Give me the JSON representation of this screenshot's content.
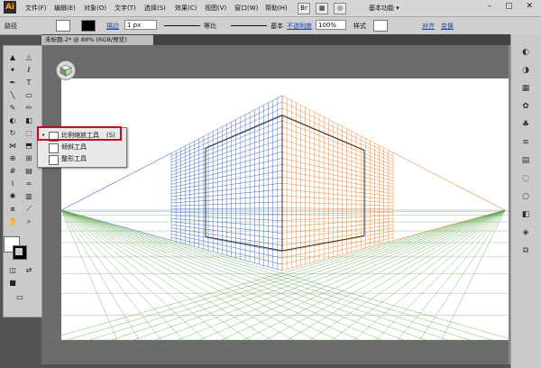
{
  "app": {
    "logo": "Ai",
    "menus": [
      "文件(F)",
      "编辑(E)",
      "对象(O)",
      "文字(T)",
      "选择(S)",
      "效果(C)",
      "视图(V)",
      "窗口(W)",
      "帮助(H)"
    ],
    "workspace": "基本功能 ▾",
    "window_controls": "– ▢ ✕"
  },
  "controlbar": {
    "selection_label": "路径",
    "stroke_label": "描边",
    "stroke_weight": "1 px",
    "stroke_profile_label": "等比",
    "brush_label": "基本",
    "opacity_label": "不透明度",
    "opacity_value": "100%",
    "style_label": "样式",
    "align_label": "对齐",
    "transform_label": "变换"
  },
  "document": {
    "tab_title": "未标题-2* @ 88% (RGB/预览)"
  },
  "tools": [
    {
      "name": "selection-tool-icon",
      "glyph": "▲"
    },
    {
      "name": "direct-selection-tool-icon",
      "glyph": "△"
    },
    {
      "name": "magic-wand-icon",
      "glyph": "✦"
    },
    {
      "name": "lasso-icon",
      "glyph": "ℓ"
    },
    {
      "name": "pen-tool-icon",
      "glyph": "✒"
    },
    {
      "name": "type-tool-icon",
      "glyph": "T"
    },
    {
      "name": "line-tool-icon",
      "glyph": "╲"
    },
    {
      "name": "rectangle-tool-icon",
      "glyph": "▭"
    },
    {
      "name": "paintbrush-icon",
      "glyph": "✎"
    },
    {
      "name": "pencil-icon",
      "glyph": "✏"
    },
    {
      "name": "blob-brush-icon",
      "glyph": "◐"
    },
    {
      "name": "eraser-icon",
      "glyph": "◧"
    },
    {
      "name": "rotate-tool-icon",
      "glyph": "↻"
    },
    {
      "name": "scale-tool-icon",
      "glyph": "⬚"
    },
    {
      "name": "width-tool-icon",
      "glyph": "⋈"
    },
    {
      "name": "free-transform-icon",
      "glyph": "⬒"
    },
    {
      "name": "shape-builder-icon",
      "glyph": "⊕"
    },
    {
      "name": "perspective-grid-icon",
      "glyph": "⊞"
    },
    {
      "name": "mesh-tool-icon",
      "glyph": "#"
    },
    {
      "name": "gradient-tool-icon",
      "glyph": "▤"
    },
    {
      "name": "eyedropper-icon",
      "glyph": "⌇"
    },
    {
      "name": "blend-tool-icon",
      "glyph": "∞"
    },
    {
      "name": "symbol-sprayer-icon",
      "glyph": "✺"
    },
    {
      "name": "column-graph-icon",
      "glyph": "▥"
    },
    {
      "name": "artboard-tool-icon",
      "glyph": "⧈"
    },
    {
      "name": "slice-tool-icon",
      "glyph": "⟋"
    },
    {
      "name": "hand-tool-icon",
      "glyph": "✋"
    },
    {
      "name": "zoom-tool-icon",
      "glyph": "⌕"
    }
  ],
  "flyout": {
    "items": [
      {
        "label": "比例缩放工具",
        "key": "(S)",
        "bullet": "•"
      },
      {
        "label": "倾斜工具",
        "key": "",
        "bullet": ""
      },
      {
        "label": "整形工具",
        "key": "",
        "bullet": ""
      }
    ]
  },
  "right_panel": {
    "icons": [
      "color-icon",
      "color-guide-icon",
      "swatches-icon",
      "brushes-icon",
      "symbols-icon",
      "stroke-icon",
      "gradient-icon",
      "transparency-icon",
      "appearance-icon",
      "graphic-styles-icon",
      "layers-icon",
      "artboards-icon"
    ]
  },
  "colors": {
    "grid_left": "#4a6fc1",
    "grid_right": "#f08a3c",
    "grid_ground": "#5aa34a",
    "highlight": "#d0021b"
  }
}
